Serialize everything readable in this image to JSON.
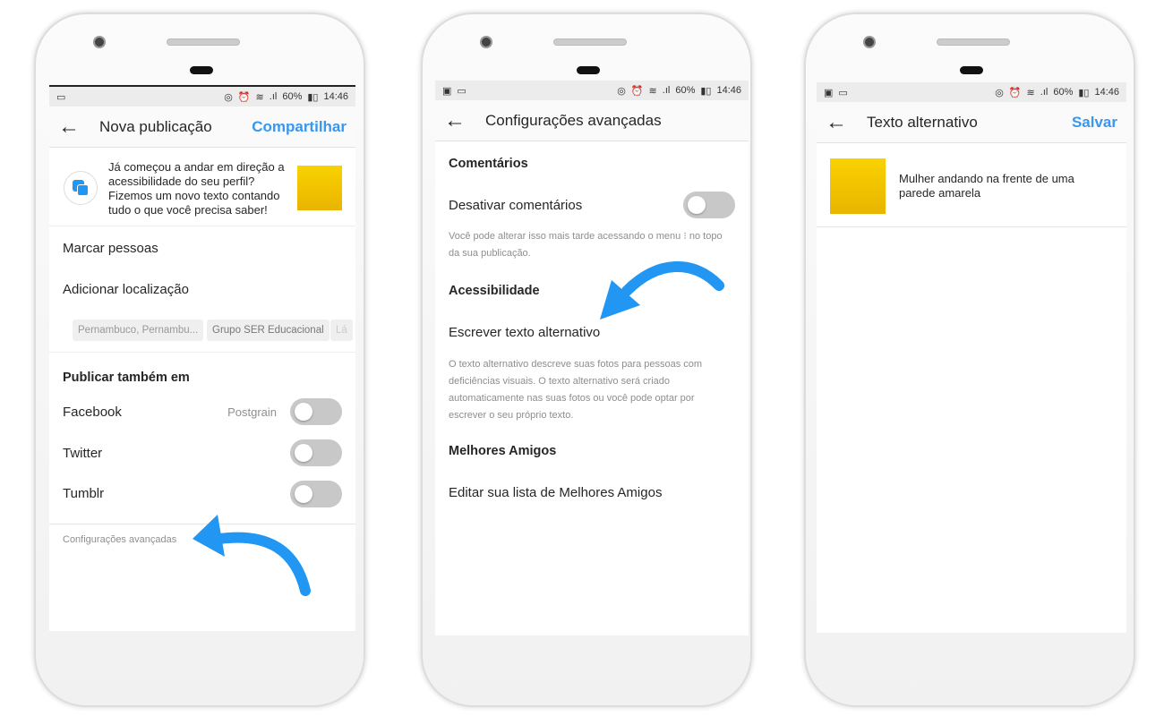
{
  "status": {
    "battery": "60%",
    "time": "14:46"
  },
  "screen1": {
    "title": "Nova publicação",
    "action": "Compartilhar",
    "promo": "Já começou a andar em direção a acessibilidade do seu perfil? Fizemos um novo texto contando tudo o que você precisa saber!",
    "tag_people": "Marcar pessoas",
    "add_location": "Adicionar localização",
    "location_chips": [
      "Pernambuco, Pernambu...",
      "Grupo SER Educacional",
      "Lá"
    ],
    "share_heading": "Publicar também em",
    "share": [
      {
        "label": "Facebook",
        "account": "Postgrain",
        "on": false
      },
      {
        "label": "Twitter",
        "on": false
      },
      {
        "label": "Tumblr",
        "on": false
      }
    ],
    "advanced": "Configurações avançadas"
  },
  "screen2": {
    "title": "Configurações avançadas",
    "comments_heading": "Comentários",
    "disable_comments": "Desativar comentários",
    "disable_comments_on": false,
    "comments_note": "Você pode alterar isso mais tarde acessando o menu ⁝ no topo da sua publicação.",
    "accessibility_heading": "Acessibilidade",
    "alt_text": "Escrever texto alternativo",
    "alt_note": "O texto alternativo descreve suas fotos para pessoas com deficiências visuais. O texto alternativo será criado automaticamente nas suas fotos ou você pode optar por escrever o seu próprio texto.",
    "friends_heading": "Melhores Amigos",
    "edit_friends": "Editar sua lista de Melhores Amigos"
  },
  "screen3": {
    "title": "Texto alternativo",
    "action": "Salvar",
    "alt_value": "Mulher andando na frente de uma parede amarela"
  },
  "colors": {
    "accent": "#3897f0",
    "arrow": "#2196f3",
    "photo": "#f5c800"
  }
}
